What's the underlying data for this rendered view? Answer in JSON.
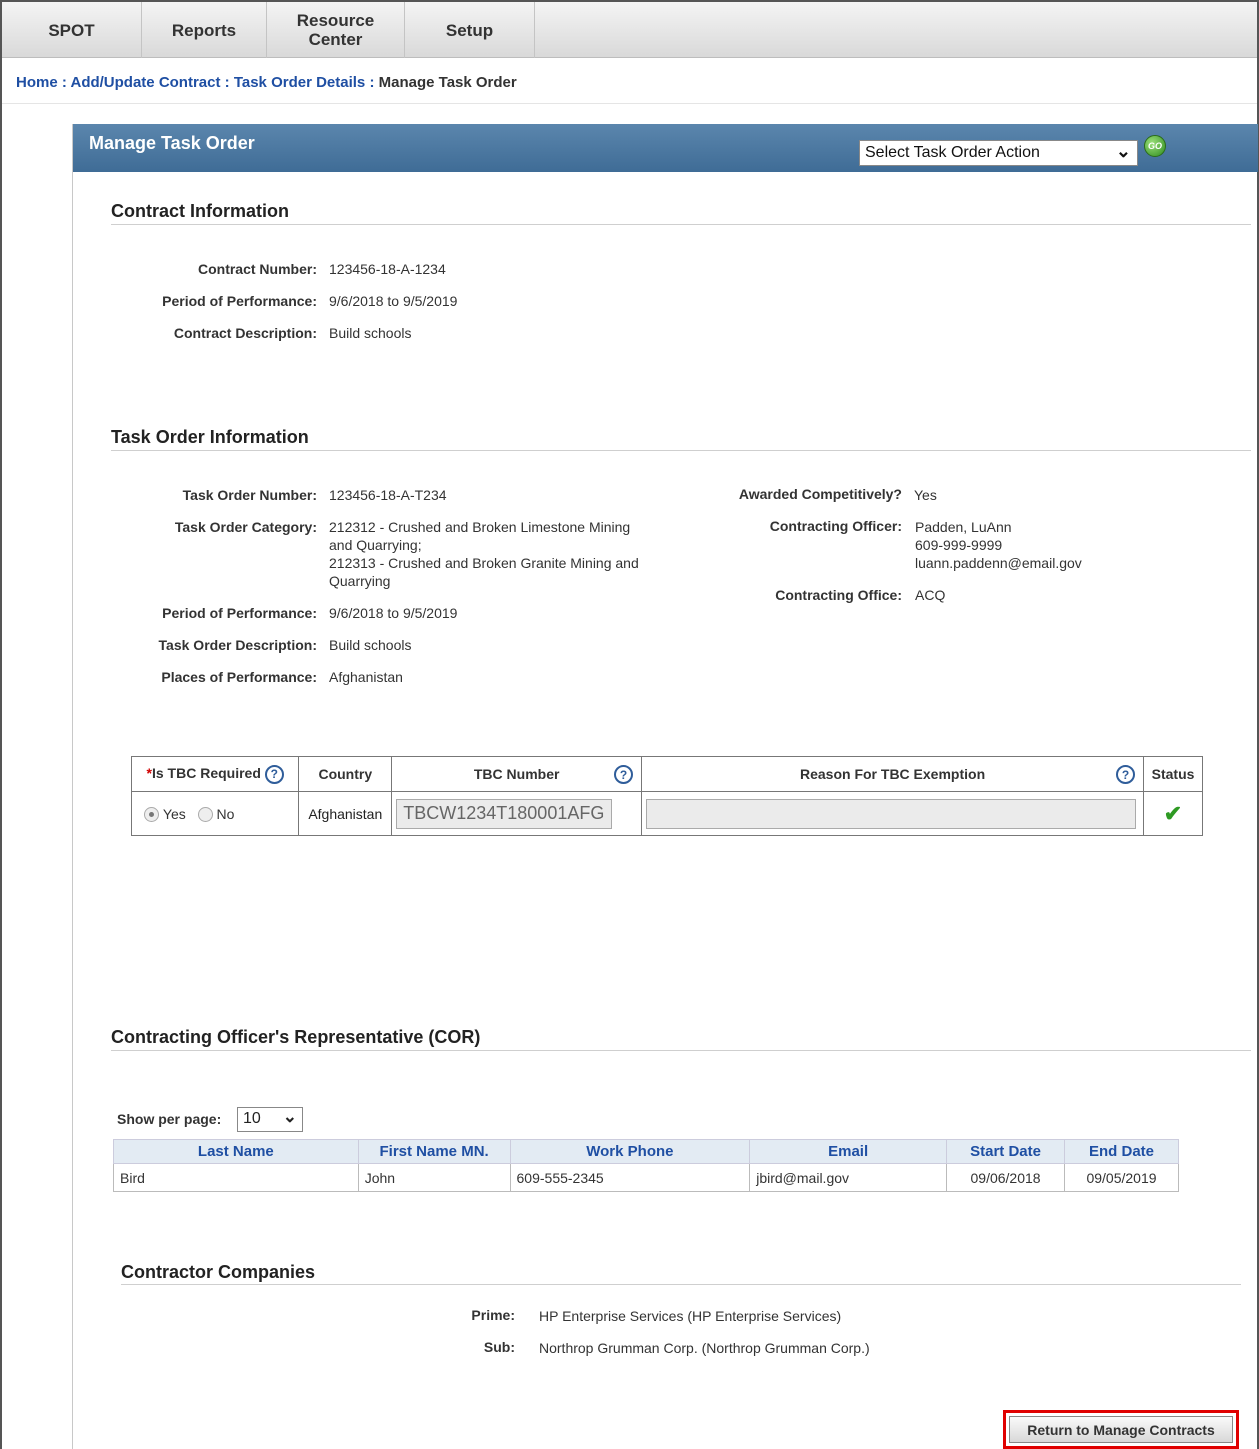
{
  "nav": {
    "items": [
      {
        "label": "SPOT"
      },
      {
        "label": "Reports"
      },
      {
        "label": "Resource\nCenter"
      },
      {
        "label": "Setup"
      }
    ]
  },
  "breadcrumb": {
    "home": "Home",
    "add_update": "Add/Update Contract",
    "task_details": "Task Order Details",
    "current": "Manage Task Order",
    "separator": ":"
  },
  "panel": {
    "title": "Manage Task Order",
    "action_select": "Select Task Order Action",
    "go_label": "GO"
  },
  "contract": {
    "title": "Contract Information",
    "number_label": "Contract Number:",
    "number": "123456-18-A-1234",
    "period_label": "Period of Performance:",
    "period": "9/6/2018 to 9/5/2019",
    "desc_label": "Contract Description:",
    "desc": "Build schools"
  },
  "task_order": {
    "title": "Task Order Information",
    "number_label": "Task Order Number:",
    "number": "123456-18-A-T234",
    "category_label": "Task Order Category:",
    "category_1": "212312 - Crushed and Broken Limestone Mining",
    "category_2": "and Quarrying;",
    "category_3": "212313 - Crushed and Broken Granite Mining and",
    "category_4": "Quarrying",
    "period_label": "Period of Performance:",
    "period": "9/6/2018 to 9/5/2019",
    "desc_label": "Task Order Description:",
    "desc": "Build schools",
    "places_label": "Places of Performance:",
    "places": "Afghanistan",
    "awarded_label": "Awarded Competitively?",
    "awarded": "Yes",
    "officer_label": "Contracting Officer:",
    "officer_name": "Padden, LuAnn",
    "officer_phone": "609-999-9999",
    "officer_email": "luann.paddenn@email.gov",
    "office_label": "Contracting Office:",
    "office": "ACQ"
  },
  "tbc": {
    "headers": {
      "required_mark": "*",
      "required": "Is TBC Required",
      "country": "Country",
      "number": "TBC Number",
      "reason": "Reason For TBC Exemption",
      "status": "Status"
    },
    "row": {
      "yes": "Yes",
      "no": "No",
      "country": "Afghanistan",
      "tbc_number": "TBCW1234T180001AFG",
      "reason": ""
    }
  },
  "cor": {
    "title": "Contracting Officer's Representative (COR)",
    "per_page_label": "Show per page:",
    "per_page": "10",
    "columns": [
      "Last Name",
      "First Name MN.",
      "Work Phone",
      "Email",
      "Start Date",
      "End Date"
    ],
    "rows": [
      [
        "Bird",
        "John",
        "609-555-2345",
        "jbird@mail.gov",
        "09/06/2018",
        "09/05/2019"
      ]
    ]
  },
  "companies": {
    "title": "Contractor Companies",
    "prime_label": "Prime:",
    "prime": "HP Enterprise Services (HP Enterprise Services)",
    "sub_label": "Sub:",
    "sub": "Northrop Grumman Corp. (Northrop Grumman Corp.)"
  },
  "return_button": "Return to Manage Contracts"
}
